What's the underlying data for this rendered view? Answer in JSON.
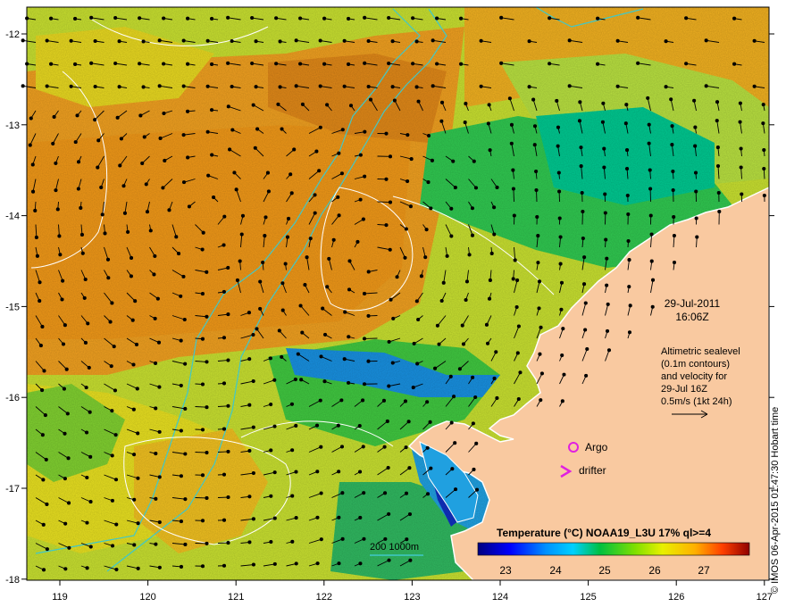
{
  "date_line1": "29-Jul-2011",
  "date_line2": "16:06Z",
  "info_lines": [
    "Altimetric sealevel",
    "(0.1m contours)",
    "and velocity for",
    "29-Jul 16Z",
    "0.5m/s (1kt 24h)"
  ],
  "legend": {
    "argo": "Argo",
    "drifter": "drifter",
    "isobath": "200  1000m"
  },
  "colorbar": {
    "title": "Temperature (°C) NOAA19_L3U 17% ql>=4",
    "ticks": [
      "23",
      "24",
      "25",
      "26",
      "27"
    ]
  },
  "credit": "© IMOS 06-Apr-2015 01:47:30 Hobart time",
  "axes": {
    "x_ticks": [
      "119",
      "120",
      "121",
      "122",
      "123",
      "124",
      "125",
      "126",
      "127"
    ],
    "y_ticks": [
      "-12",
      "-13",
      "-14",
      "-15",
      "-16",
      "-17",
      "-18"
    ]
  },
  "colors": {
    "land": "#f9c9a0",
    "isobath": "#40c8c8",
    "contour": "#ffffff",
    "marker": "#e020e0"
  }
}
